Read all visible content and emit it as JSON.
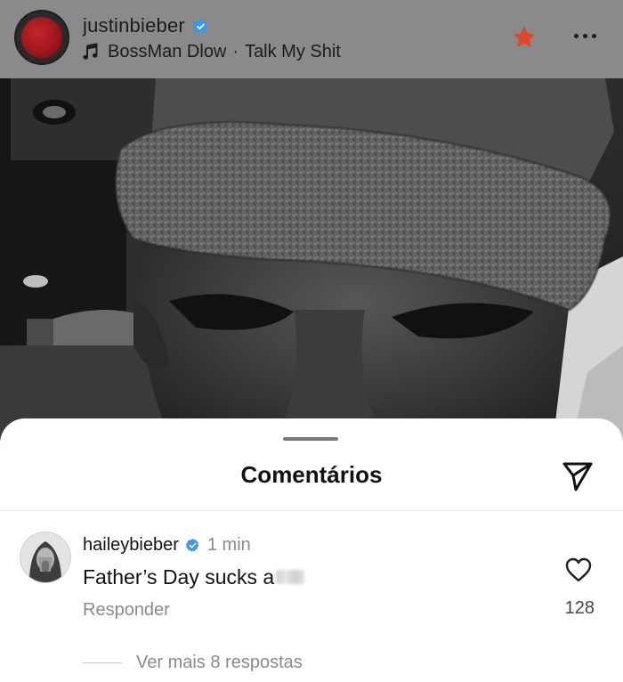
{
  "post_header": {
    "username": "justinbieber",
    "verified_icon": "verified-badge-icon",
    "music_icon": "music-note-icon",
    "music_artist": "BossMan Dlow",
    "music_separator": "·",
    "music_track": "Talk My Shit",
    "star_icon": "star-icon",
    "more_icon": "more-options-icon",
    "star_color": "#e0472a"
  },
  "comments_sheet": {
    "title": "Comentários",
    "share_icon": "send-icon"
  },
  "comment": {
    "username": "haileybieber",
    "time": "1 min",
    "text": "Father’s Day sucks a",
    "reply_label": "Responder",
    "like_icon": "heart-outline-icon",
    "like_count": "128",
    "view_more_label": "Ver mais 8 respostas"
  },
  "colors": {
    "verified": "#3897f0",
    "secondary_text": "#8a8a8a"
  }
}
